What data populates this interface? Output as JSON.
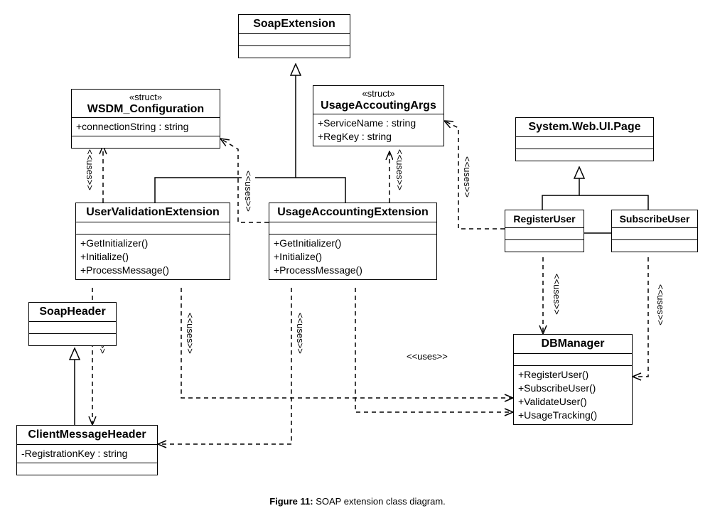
{
  "caption": {
    "label": "Figure 11:",
    "text": " SOAP extension class diagram."
  },
  "rel": {
    "uses": "<<uses>>"
  },
  "classes": {
    "SoapExtension": {
      "name": "SoapExtension",
      "attrs": [],
      "ops": []
    },
    "WSDM_Configuration": {
      "stereo": "«struct»",
      "name": "WSDM_Configuration",
      "attrs": [
        "+connectionString : string"
      ],
      "ops": []
    },
    "UsageAccoutingArgs": {
      "stereo": "«struct»",
      "name": "UsageAccoutingArgs",
      "attrs": [
        "+ServiceName : string",
        "+RegKey : string"
      ],
      "ops": []
    },
    "SystemWebUIPage": {
      "name": "System.Web.UI.Page",
      "attrs": [],
      "ops": []
    },
    "UserValidationExtension": {
      "name": "UserValidationExtension",
      "attrs": [],
      "ops": [
        "+GetInitializer()",
        "+Initialize()",
        "+ProcessMessage()"
      ]
    },
    "UsageAccountingExtension": {
      "name": "UsageAccountingExtension",
      "attrs": [],
      "ops": [
        "+GetInitializer()",
        "+Initialize()",
        "+ProcessMessage()"
      ]
    },
    "RegisterUser": {
      "name": "RegisterUser",
      "attrs": [],
      "ops": []
    },
    "SubscribeUser": {
      "name": "SubscribeUser",
      "attrs": [],
      "ops": []
    },
    "SoapHeader": {
      "name": "SoapHeader",
      "attrs": [],
      "ops": []
    },
    "DBManager": {
      "name": "DBManager",
      "attrs": [],
      "ops": [
        "+RegisterUser()",
        "+SubscribeUser()",
        "+ValidateUser()",
        "+UsageTracking()"
      ]
    },
    "ClientMessageHeader": {
      "name": "ClientMessageHeader",
      "attrs": [
        "-RegistrationKey : string"
      ],
      "ops": []
    }
  }
}
